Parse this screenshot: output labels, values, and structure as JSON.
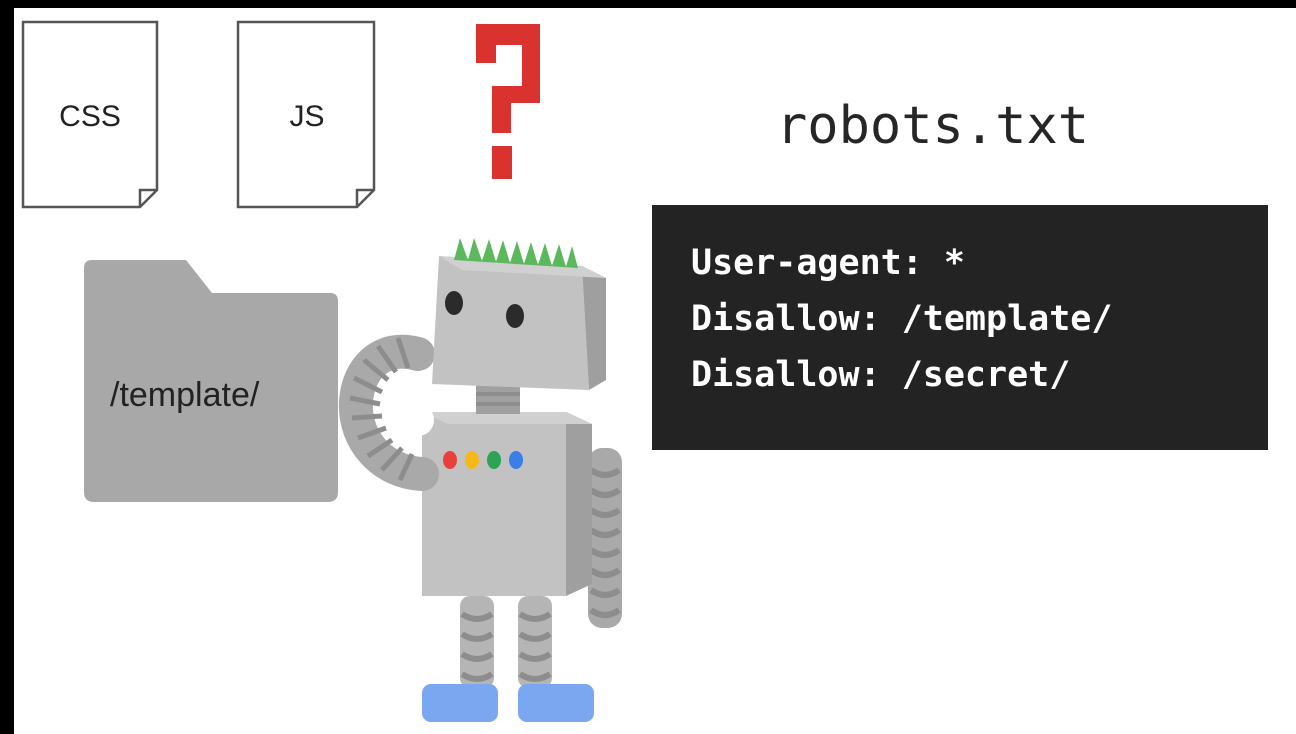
{
  "files": [
    {
      "label": "CSS"
    },
    {
      "label": "JS"
    }
  ],
  "folder": {
    "label": "/template/"
  },
  "question_mark": {
    "glyph": "?",
    "color": "#d9322f"
  },
  "robots_file": {
    "title": "robots.txt",
    "lines": [
      "User-agent: *",
      "Disallow: /template/",
      "Disallow: /secret/"
    ]
  },
  "robot": {
    "indicator_colors": [
      "#e8413a",
      "#f5b818",
      "#2da356",
      "#3b7ee8"
    ],
    "hair_color": "#5cb85c",
    "feet_color": "#7aa7f0",
    "body_color": "#bfbfbf"
  }
}
